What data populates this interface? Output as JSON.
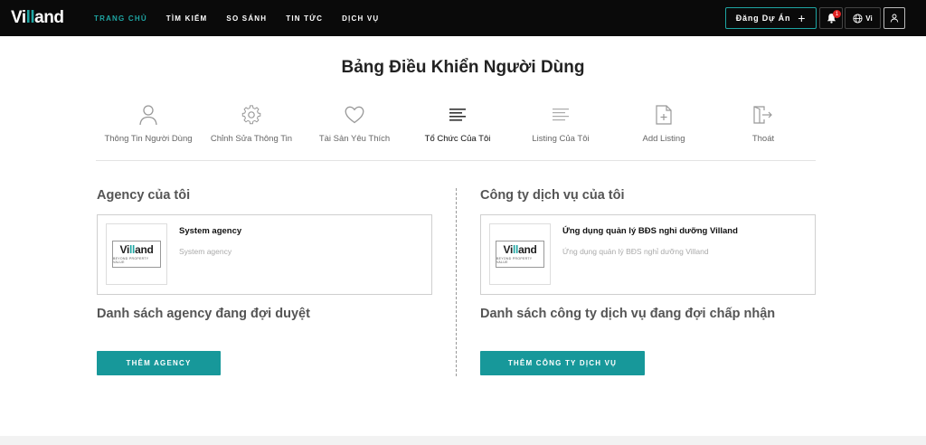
{
  "header": {
    "logo": {
      "part1": "Vi",
      "part2": "ll",
      "part3": "and"
    },
    "nav": [
      {
        "label": "TRANG CHỦ",
        "active": true
      },
      {
        "label": "TÌM KIẾM",
        "active": false
      },
      {
        "label": "SO SÁNH",
        "active": false
      },
      {
        "label": "TIN TỨC",
        "active": false
      },
      {
        "label": "DỊCH VỤ",
        "active": false
      }
    ],
    "post_button": "Đăng Dự Án",
    "post_button_plus": "+",
    "notification_count": "1",
    "language": "Vi"
  },
  "page": {
    "title": "Bảng Điều Khiển Người Dùng"
  },
  "tabs": [
    {
      "label": "Thông Tin Người Dùng",
      "icon": "user-icon"
    },
    {
      "label": "Chỉnh Sửa Thông Tin",
      "icon": "gear-icon"
    },
    {
      "label": "Tài Sản Yêu Thích",
      "icon": "heart-icon"
    },
    {
      "label": "Tổ Chức Của Tôi",
      "icon": "align-left-icon",
      "active": true
    },
    {
      "label": "Listing Của Tôi",
      "icon": "list-icon"
    },
    {
      "label": "Add Listing",
      "icon": "file-plus-icon"
    },
    {
      "label": "Thoát",
      "icon": "logout-icon"
    }
  ],
  "agency": {
    "title": "Agency của tôi",
    "card": {
      "name": "System agency",
      "desc": "System agency"
    },
    "pending_title": "Danh sách agency đang đợi duyệt",
    "button": "THÊM AGENCY"
  },
  "service": {
    "title": "Công ty dịch vụ của tôi",
    "card": {
      "name": "Ứng dụng quản lý BĐS nghỉ dưỡng Villand",
      "desc": "Ứng dụng quản lý BĐS nghỉ dưỡng Villand"
    },
    "pending_title": "Danh sách công ty dịch vụ đang đợi chấp nhận",
    "button": "THÊM CÔNG TY DỊCH VỤ"
  },
  "thumb_logo": {
    "part1": "Vi",
    "part2": "ll",
    "part3": "and",
    "tagline": "BEYOND PROPERTY VALUE"
  },
  "colors": {
    "accent": "#1ea5a3",
    "button": "#17989a",
    "header": "#0a0a0a",
    "badge": "#e02424"
  }
}
